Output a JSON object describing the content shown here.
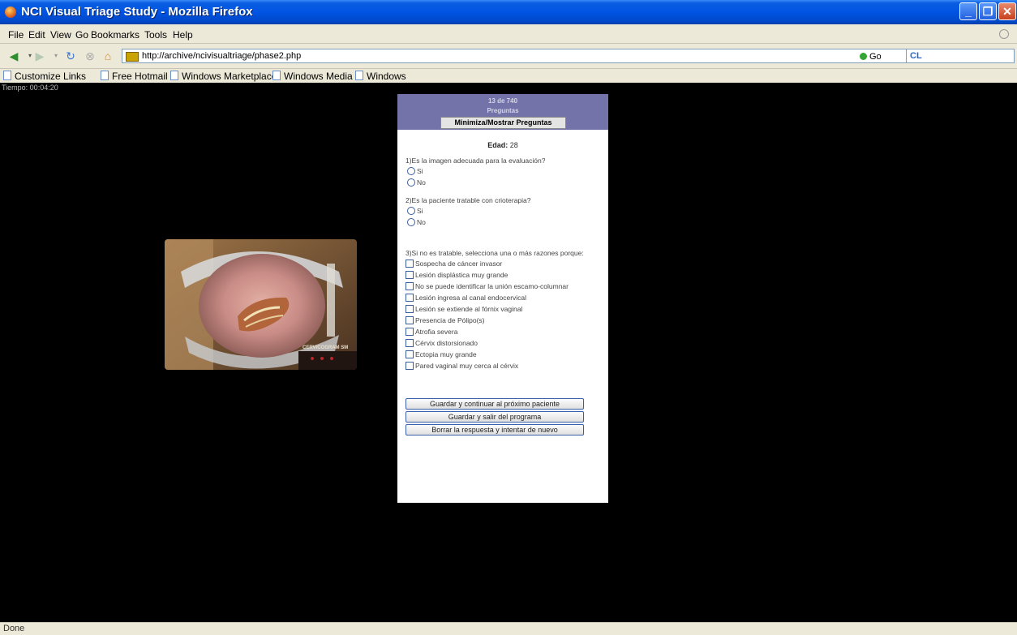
{
  "window": {
    "title": "NCI Visual Triage Study - Mozilla Firefox"
  },
  "menu": [
    "File",
    "Edit",
    "View",
    "Go",
    "Bookmarks",
    "Tools",
    "Help"
  ],
  "address": {
    "url": "http://archive/ncivisualtriage/phase2.php",
    "go_label": "Go",
    "search_value": "CL"
  },
  "bookmarks": [
    "Customize Links",
    "Free Hotmail",
    "Windows Marketplace",
    "Windows Media",
    "Windows"
  ],
  "page": {
    "timer": "Tiempo: 00:04:20",
    "image_stamp": "CERVICOGRAM SM",
    "panel": {
      "counter": "13 de 740",
      "section": "Preguntas",
      "toggle_label": "Minimiza/Mostrar Preguntas",
      "age_label": "Edad:",
      "age_value": "28",
      "q1": {
        "text": "1)Es la imagen adecuada para la evaluación?",
        "options": [
          "Si",
          "No"
        ]
      },
      "q2": {
        "text": "2)Es la paciente tratable con crioterapia?",
        "options": [
          "Si",
          "No"
        ]
      },
      "q3": {
        "text": "3)Si no es tratable, selecciona una o más razones porque:",
        "reasons": [
          "Sospecha de cáncer invasor",
          "Lesión displástica muy grande",
          "No se puede identificar la unión escamo-columnar",
          "Lesión ingresa al canal endocervical",
          "Lesión se extiende al fórnix vaginal",
          "Presencia de Pólipo(s)",
          "Atrofia severa",
          "Cérvix distorsionado",
          "Ectopia muy grande",
          "Pared vaginal muy cerca al cérvix"
        ]
      },
      "buttons": {
        "next": "Guardar y continuar al próximo paciente",
        "save_exit": "Guardar y salir del programa",
        "reset": "Borrar la respuesta y intentar de nuevo"
      }
    }
  },
  "status": {
    "text": "Done"
  }
}
